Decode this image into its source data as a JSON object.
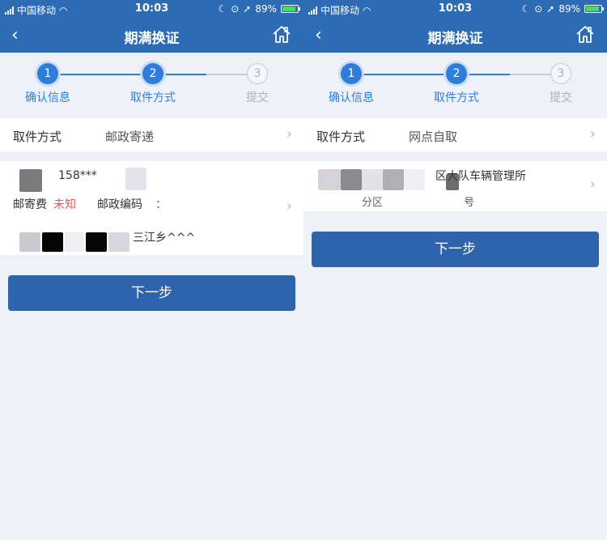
{
  "status_bar": {
    "carrier": "中国移动",
    "time": "10:03",
    "battery": "89%"
  },
  "nav": {
    "title": "期满换证",
    "back": "‹"
  },
  "steps": [
    {
      "num": "1",
      "label": "确认信息"
    },
    {
      "num": "2",
      "label": "取件方式"
    },
    {
      "num": "3",
      "label": "提交"
    }
  ],
  "left": {
    "method_label": "取件方式",
    "method_value": "邮政寄递",
    "phone": "158***",
    "postage_label": "邮寄费",
    "postage_value": "未知",
    "postcode_label": "邮政编码",
    "postcode_value": "：",
    "address": "三江乡^^^"
  },
  "right": {
    "method_label": "取件方式",
    "method_value": "网点自取",
    "office": "区大队车辆管理所",
    "district_fragment": "分区",
    "number_fragment": "号"
  },
  "next_button": "下一步",
  "colors": {
    "header": "#2d6bb5",
    "accent": "#2f7ddb",
    "warning": "#e85757",
    "button": "#2e64ab"
  }
}
